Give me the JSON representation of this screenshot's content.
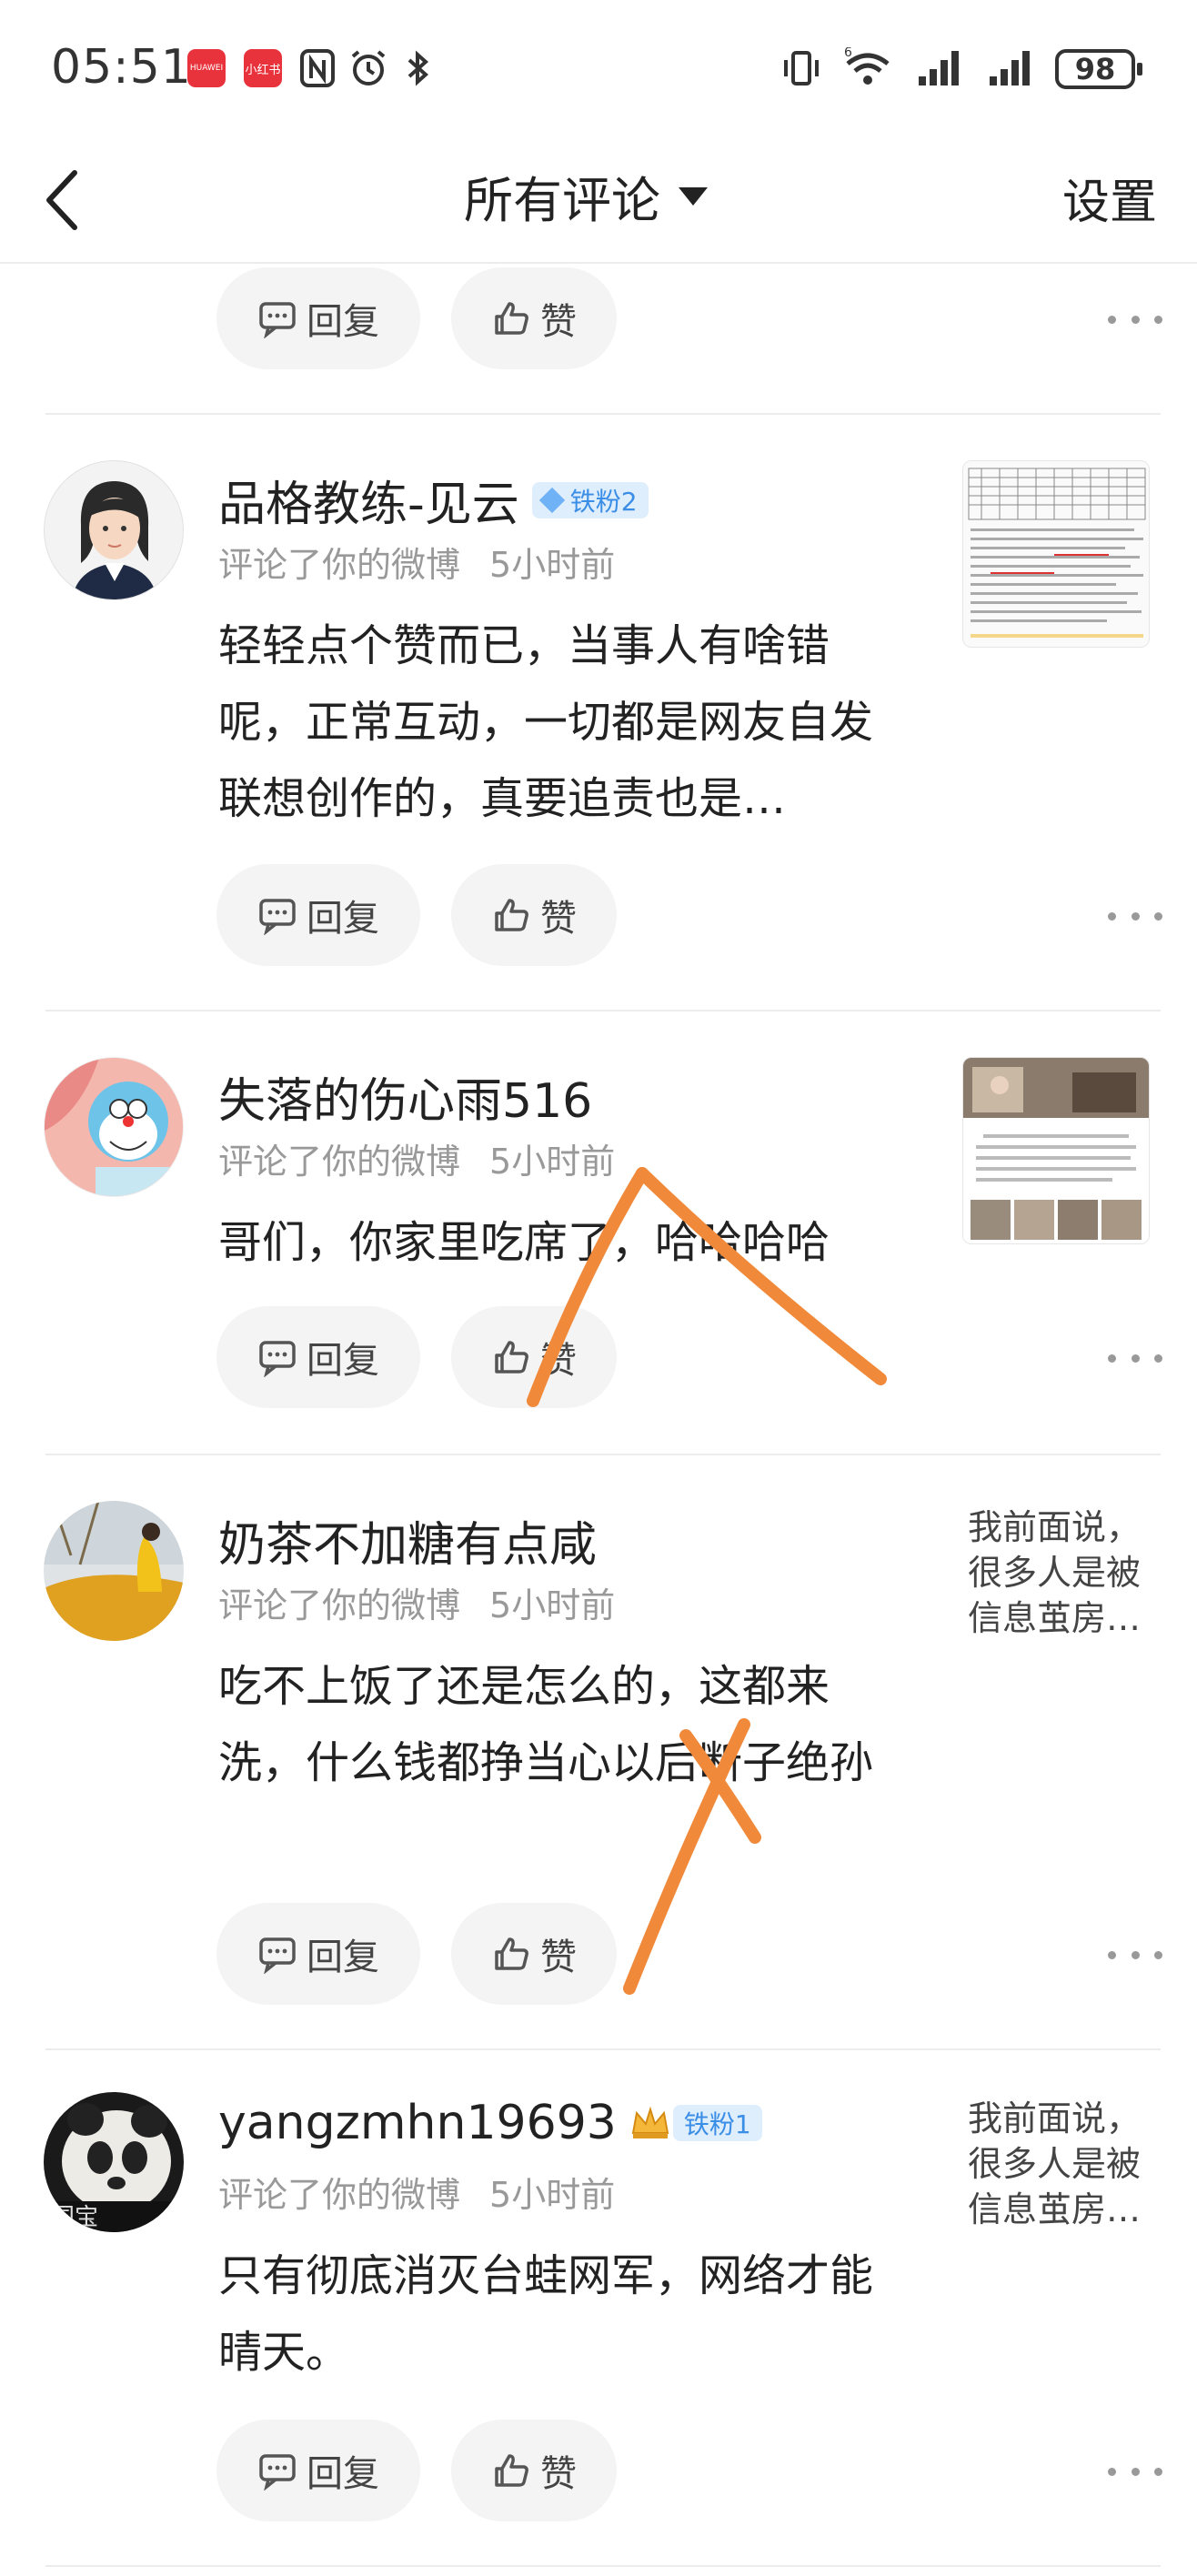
{
  "status_bar": {
    "time": "05:51",
    "app_badges": [
      "HUAWEI",
      "小红书"
    ],
    "network": "6",
    "battery": "98"
  },
  "nav": {
    "title": "所有评论",
    "settings": "设置"
  },
  "actions": {
    "reply": "回复",
    "like": "赞"
  },
  "comments": [
    {
      "username": "品格教练-见云",
      "badge": "铁粉2",
      "action": "评论了你的微博",
      "time": "5小时前",
      "text": "轻轻点个赞而已，当事人有啥错呢，正常互动，一切都是网友自发联想创作的，真要追责也是…",
      "preview": "image"
    },
    {
      "username": "失落的伤心雨516",
      "badge": "",
      "action": "评论了你的微博",
      "time": "5小时前",
      "text": "哥们，你家里吃席了，哈哈哈哈",
      "preview": "image"
    },
    {
      "username": "奶茶不加糖有点咸",
      "badge": "",
      "action": "评论了你的微博",
      "time": "5小时前",
      "text": "吃不上饭了还是怎么的，这都来洗，什么钱都挣当心以后断子绝孙",
      "preview_text": [
        "我前面说，",
        "很多人是被",
        "信息茧房…"
      ]
    },
    {
      "username": "yangzmhn19693",
      "badge": "铁粉1",
      "action": "评论了你的微博",
      "time": "5小时前",
      "text": "只有彻底消灭台蛙网军，网络才能晴天。",
      "preview_text": [
        "我前面说，",
        "很多人是被",
        "信息茧房…"
      ]
    }
  ],
  "colors": {
    "annotation": "#f0893a",
    "badge_bg": "#dfeefc",
    "badge_text": "#3b8ee6"
  }
}
